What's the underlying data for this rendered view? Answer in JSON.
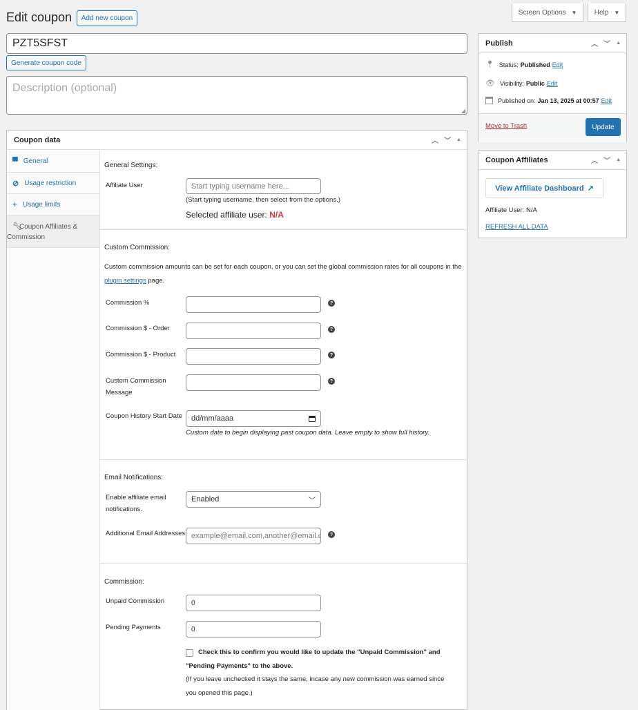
{
  "header": {
    "title": "Edit coupon",
    "add_new": "Add new coupon",
    "screen_options": "Screen Options",
    "help": "Help"
  },
  "coupon": {
    "code": "PZT5SFST",
    "generate_label": "Generate coupon code",
    "description_placeholder": "Description (optional)"
  },
  "coupon_data": {
    "title": "Coupon data",
    "tabs": [
      {
        "label": "General",
        "icon": "ticket-icon"
      },
      {
        "label": "Usage restriction",
        "icon": "block-icon"
      },
      {
        "label": "Usage limits",
        "icon": "plus-icon"
      },
      {
        "label": "Coupon Affiliates & Commission",
        "icon": "wrench-icon"
      }
    ],
    "general": {
      "heading": "General Settings:",
      "affiliate_label": "Affiliate User",
      "affiliate_placeholder": "Start typing username here...",
      "affiliate_hint": "(Start typing username, then select from the options.)",
      "selected_label": "Selected affiliate user:",
      "selected_value": "N/A"
    },
    "custom": {
      "heading": "Custom Commission:",
      "desc_before": "Custom commission amounts can be set for each coupon, or you can set the global commission rates for all coupons in the",
      "link": "plugin settings",
      "desc_after": "page.",
      "pct_label": "Commission %",
      "order_label": "Commission $ - Order",
      "product_label": "Commission $ - Product",
      "message_label_1": "Custom Commission",
      "message_label_2": "Message",
      "history_label": "Coupon History Start Date",
      "date_placeholder": "dd/mm/aaaa",
      "history_hint": "Custom date to begin displaying past coupon data. Leave empty to show full history."
    },
    "email": {
      "heading": "Email Notifications:",
      "enable_label_1": "Enable affiliate email",
      "enable_label_2": "notifications.",
      "enable_value": "Enabled",
      "additional_label": "Additional Email Addresses",
      "additional_placeholder": "example@email.com,another@email.c"
    },
    "commission": {
      "heading": "Commission:",
      "unpaid_label": "Unpaid Commission",
      "unpaid_value": "0",
      "pending_label": "Pending Payments",
      "pending_value": "0",
      "confirm_1": "Check this to confirm you would like to update the \"Unpaid Commission\" and",
      "confirm_2": "\"Pending Payments\" to the above.",
      "note_1": "(If you leave unchecked it stays the same, incase any new commission was earned since",
      "note_2": "you opened this page.)"
    }
  },
  "publish": {
    "title": "Publish",
    "status_label": "Status:",
    "status_value": "Published",
    "visibility_label": "Visibility:",
    "visibility_value": "Public",
    "published_label": "Published on:",
    "published_value": "Jan 13, 2025 at 00:57",
    "edit": "Edit",
    "trash": "Move to Trash",
    "update": "Update"
  },
  "affiliates": {
    "title": "Coupon Affiliates",
    "dashboard": "View Affiliate Dashboard",
    "user_label": "Affiliate User: N/A",
    "refresh": "REFRESH ALL DATA"
  },
  "colors": {
    "accent": "#2271b1",
    "danger": "#d63638",
    "update_bg": "#2271b1"
  }
}
